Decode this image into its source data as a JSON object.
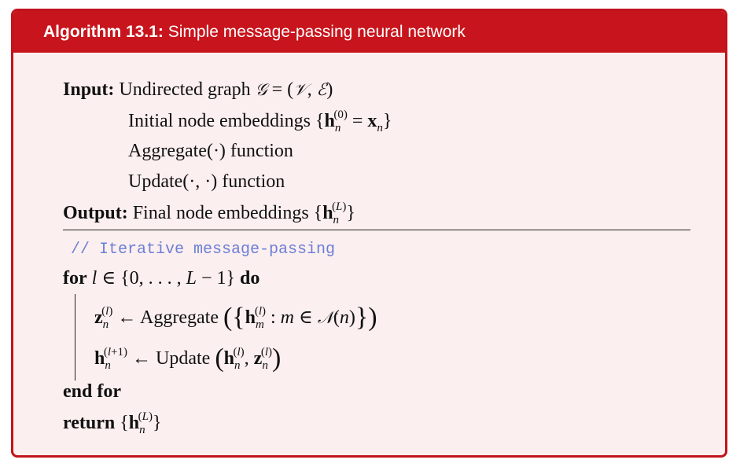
{
  "header": {
    "algorithm_label": "Algorithm 13.1:",
    "title": "Simple message-passing neural network"
  },
  "io": {
    "input_keyword": "Input:",
    "input_line1_text": "Undirected graph",
    "input_line2_text": "Initial node embeddings",
    "input_line3_text": "Aggregate(·) function",
    "input_line4_text": "Update(·, ·) function",
    "output_keyword": "Output:",
    "output_text": "Final node embeddings"
  },
  "body": {
    "comment": "// Iterative message-passing",
    "for_keyword": "for",
    "do_keyword": "do",
    "aggregate_text": "Aggregate",
    "update_text": "Update",
    "end_for_keyword": "end for",
    "return_keyword": "return"
  }
}
